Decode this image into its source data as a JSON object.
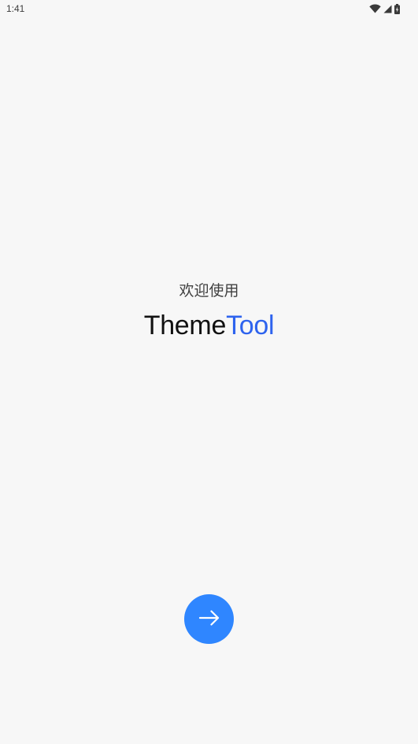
{
  "status_bar": {
    "time": "1:41",
    "icons": [
      "wifi-icon",
      "cellular-signal-icon",
      "battery-icon"
    ]
  },
  "welcome": {
    "greeting": "欢迎使用",
    "brand_part1": "Theme",
    "brand_part2": "Tool"
  },
  "next_button": {
    "icon": "arrow-right-icon"
  },
  "colors": {
    "background": "#f7f7f7",
    "brand_dark": "#111111",
    "brand_accent": "#2e63ee",
    "button": "#2f86ff"
  }
}
